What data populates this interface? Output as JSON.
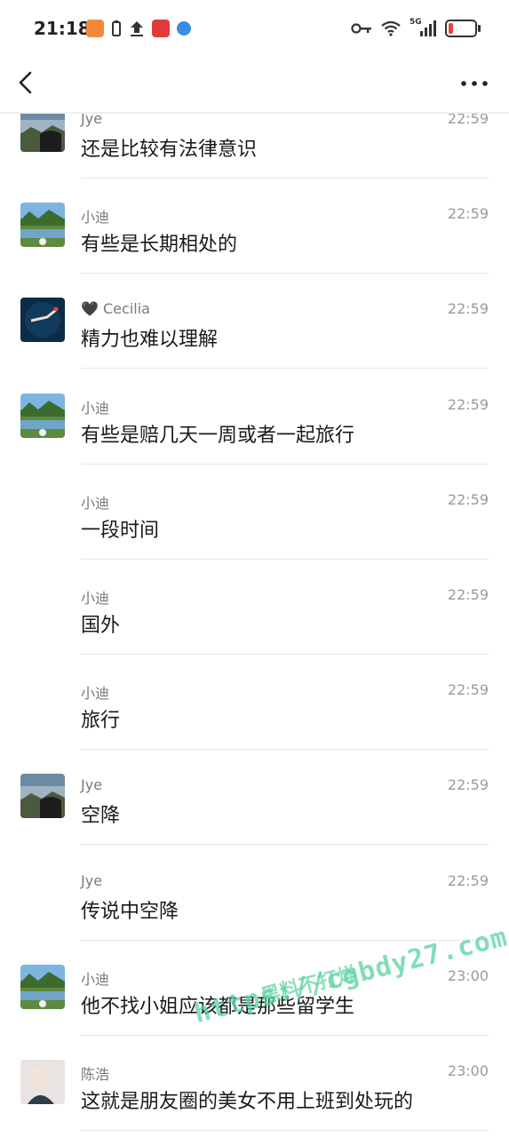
{
  "status": {
    "time": "21:18",
    "network": "5G"
  },
  "nav": {
    "back_label": "Back",
    "more_label": "More"
  },
  "messages": [
    {
      "sender": "Jye",
      "time": "22:59",
      "text": "还是比较有法律意识",
      "avatar": "landscape-dark"
    },
    {
      "sender": "小迪",
      "time": "22:59",
      "text": "有些是长期相处的",
      "avatar": "lake-green"
    },
    {
      "sender": "🖤 Cecilia",
      "time": "22:59",
      "text": "精力也难以理解",
      "avatar": "underwater"
    },
    {
      "sender": "小迪",
      "time": "22:59",
      "text": "有些是赔几天一周或者一起旅行",
      "avatar": "lake-green"
    },
    {
      "sender": "小迪",
      "time": "22:59",
      "text": "一段时间",
      "avatar": ""
    },
    {
      "sender": "小迪",
      "time": "22:59",
      "text": "国外",
      "avatar": ""
    },
    {
      "sender": "小迪",
      "time": "22:59",
      "text": "旅行",
      "avatar": ""
    },
    {
      "sender": "Jye",
      "time": "22:59",
      "text": "空降",
      "avatar": "landscape-dark"
    },
    {
      "sender": "Jye",
      "time": "22:59",
      "text": "传说中空降",
      "avatar": ""
    },
    {
      "sender": "小迪",
      "time": "23:00",
      "text": "他不找小姐应该都是那些留学生",
      "avatar": "lake-green"
    },
    {
      "sender": "陈浩",
      "time": "23:00",
      "text": "这就是朋友圈的美女不用上班到处玩的",
      "avatar": "person-light"
    }
  ],
  "watermark": {
    "url": "https://cgbdy27.com",
    "label": "黑料不打烊"
  },
  "colors": {
    "battery_low": "#e8453c",
    "watermark": "#5ad2a0"
  }
}
